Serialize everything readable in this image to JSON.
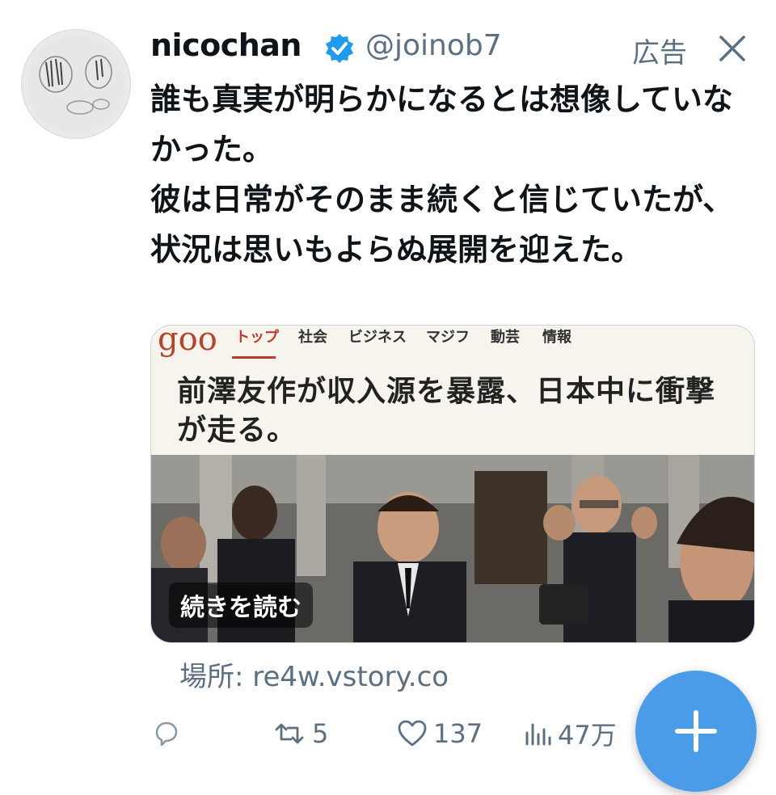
{
  "tweet": {
    "display_name": "nicochan",
    "handle": "@joinob7",
    "ad_label": "広告",
    "text": "誰も真実が明らかになるとは想像していなかった。\n彼は日常がそのまま続くと信じていたが、状況は思いもよらぬ展開を迎えた。",
    "icons": {
      "verified": "verified-badge-icon",
      "close": "close-icon"
    }
  },
  "card": {
    "logo": "goo",
    "nav": [
      "トップ",
      "社会",
      "ビジネス",
      "マジフ",
      "動芸",
      "情報"
    ],
    "active_nav": "トップ",
    "headline": "前澤友作が収入源を暴露、日本中に衝撃が走る。",
    "read_more": "続きを読む"
  },
  "source": "場所: re4w.vstory.co",
  "actions": {
    "reply_icon": "reply-icon",
    "retweet_icon": "retweet-icon",
    "retweets": "5",
    "like_icon": "heart-icon",
    "likes": "137",
    "views_icon": "views-chart-icon",
    "views": "47万"
  },
  "fab": {
    "icon": "plus-icon"
  },
  "colors": {
    "accent": "#4a9ce8",
    "muted": "#5b7083",
    "text": "#0f1419",
    "goo_red": "#b8452b"
  }
}
